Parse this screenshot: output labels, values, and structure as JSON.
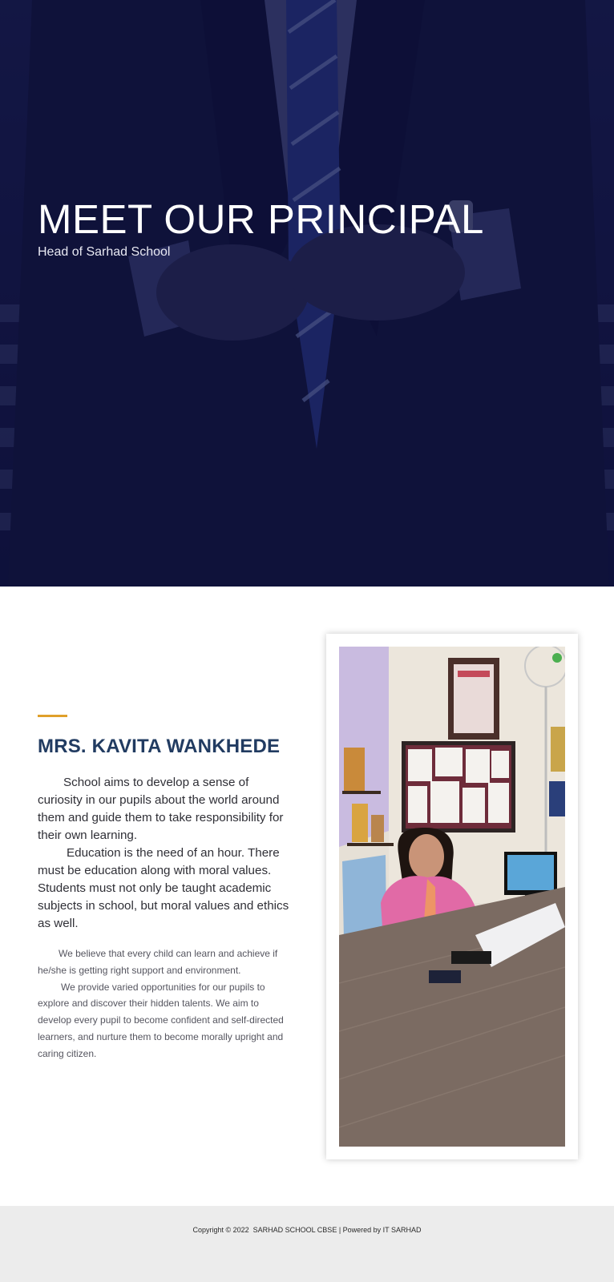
{
  "hero": {
    "title": "MEET OUR PRINCIPAL",
    "subtitle": "Head of Sarhad School",
    "overlay_color": "#0e113e"
  },
  "principal": {
    "name": "MRS. KAVITA WANKHEDE",
    "lead_paragraphs": [
      "School aims to develop a sense of curiosity in our pupils about the world around them and guide them to take responsibility for their own learning.",
      "Education is the need of an hour. There must be education along with moral values. Students must not only be taught academic subjects in school, but moral values and ethics as well."
    ],
    "body_paragraphs": [
      "We believe that every child can learn and achieve if he/she is getting right support and environment.",
      "We provide varied opportunities for our pupils to explore and discover their hidden talents. We aim to develop every pupil to become confident and self-directed learners, and nurture them to become morally upright and caring citizen."
    ],
    "accent_color": "#e0a02a",
    "name_color": "#213b61"
  },
  "footer": {
    "copyright": "Copyright © 2022  SARHAD SCHOOL CBSE | Powered by IT SARHAD"
  }
}
